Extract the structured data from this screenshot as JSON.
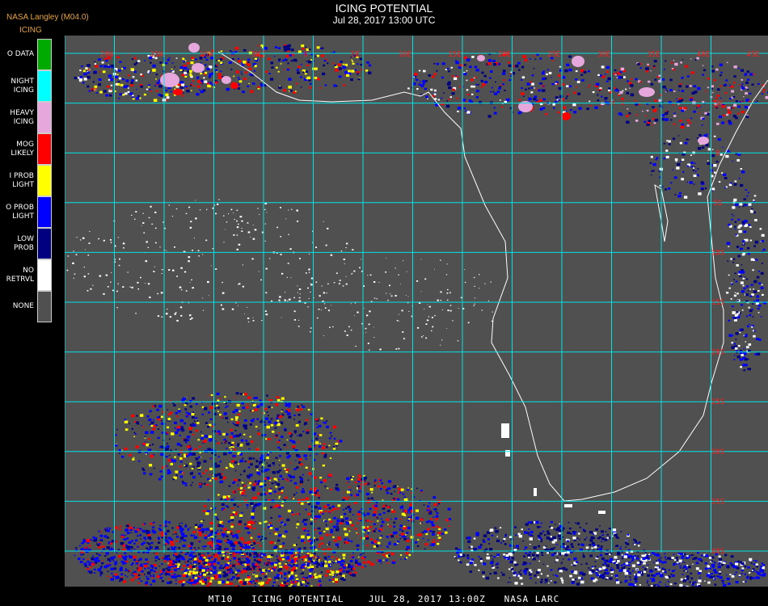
{
  "header": {
    "credit": "NASA Langley (M04.0)",
    "legend_title": "ICING",
    "title": "ICING POTENTIAL",
    "subtitle": "Jul 28, 2017 13:00 UTC"
  },
  "legend": [
    {
      "lines": [
        "O DATA"
      ],
      "color": "#00aa00"
    },
    {
      "lines": [
        "NIGHT",
        "ICING"
      ],
      "color": "#00ffff"
    },
    {
      "lines": [
        "HEAVY",
        "ICING"
      ],
      "color": "#e6a8dc"
    },
    {
      "lines": [
        "MOG",
        "LIKELY"
      ],
      "color": "#ff0000"
    },
    {
      "lines": [
        "I PROB",
        "LIGHT"
      ],
      "color": "#ffff00"
    },
    {
      "lines": [
        "O PROB",
        "LIGHT"
      ],
      "color": "#0000ff"
    },
    {
      "lines": [
        "LOW",
        "PROB"
      ],
      "color": "#000080"
    },
    {
      "lines": [
        "NO",
        "RETRVL"
      ],
      "color": "#ffffff"
    },
    {
      "lines": [
        "NONE"
      ],
      "color": "#505050"
    }
  ],
  "map": {
    "background": "#505050",
    "grid_color": "#00e5e5",
    "coast_color": "#ffffff",
    "label_color": "#ff2020",
    "lon_labels": [
      "20W",
      "15W",
      "10W",
      "5W",
      "0",
      "5E",
      "10E",
      "15E",
      "20E",
      "25E",
      "30E",
      "35E",
      "40E",
      "45E"
    ],
    "lat_labels": [
      "5N",
      "0",
      "5S",
      "10S",
      "15S",
      "20S",
      "25S",
      "30S",
      "35S",
      "40S"
    ]
  },
  "footer": {
    "text": "MT10   ICING POTENTIAL    JUL 28, 2017 13:00Z   NASA LARC"
  }
}
